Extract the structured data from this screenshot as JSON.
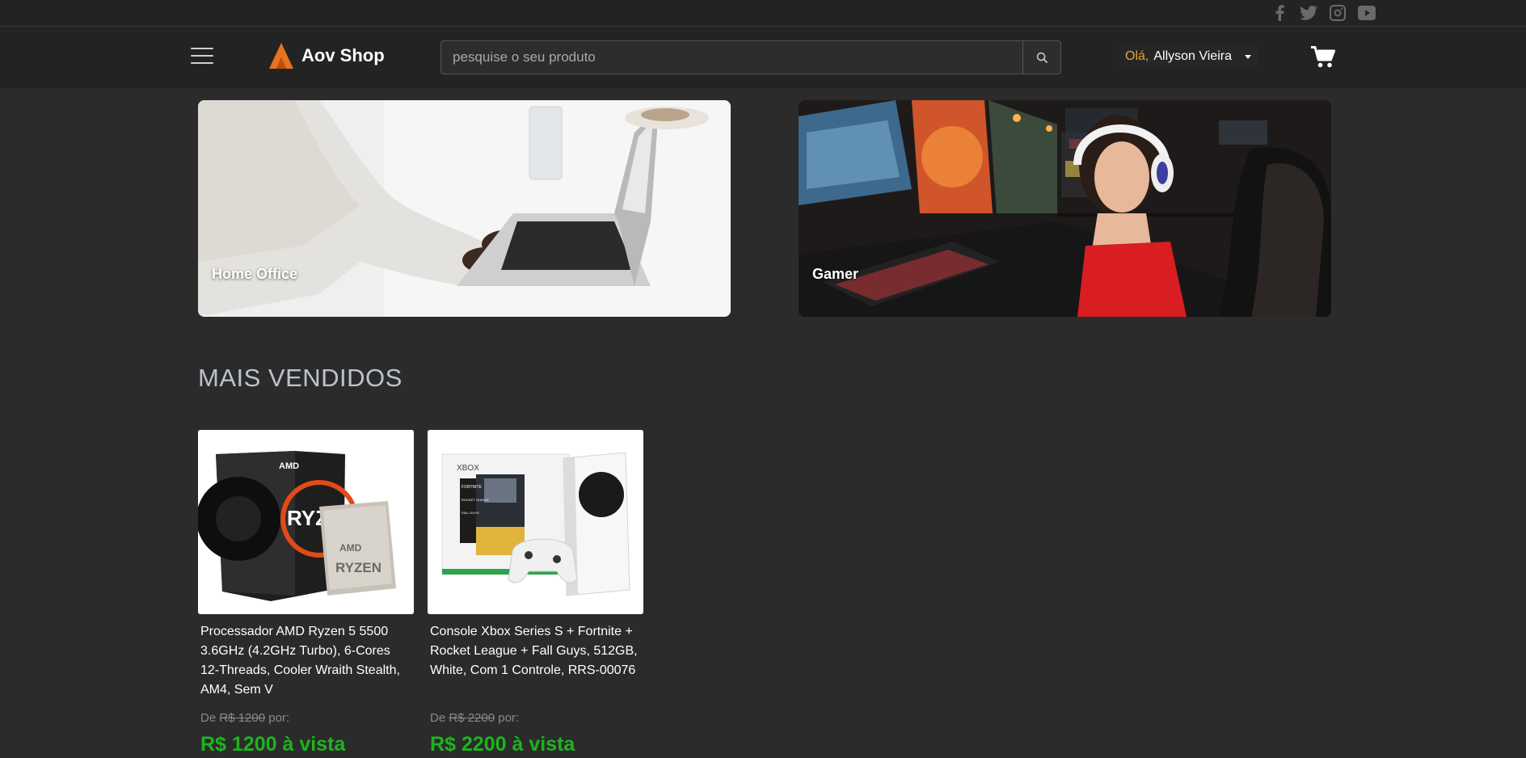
{
  "social": {
    "icons": [
      "facebook-icon",
      "twitter-icon",
      "instagram-icon",
      "youtube-icon"
    ]
  },
  "header": {
    "brand": "Aov Shop",
    "search_placeholder": "pesquise o seu produto",
    "greeting": "Olá,",
    "user_name": "Allyson Vieira",
    "colors": {
      "accent": "#f0a030",
      "logo": "#e8731f",
      "price": "#1db41d"
    }
  },
  "banners": [
    {
      "label": "Home Office"
    },
    {
      "label": "Gamer"
    }
  ],
  "section": {
    "title": "MAIS VENDIDOS"
  },
  "products": [
    {
      "title": "Processador AMD Ryzen 5 5500 3.6GHz (4.2GHz Turbo), 6-Cores 12-Threads, Cooler Wraith Stealth, AM4, Sem V",
      "old_prefix": "De",
      "old_price": "R$ 1200",
      "old_suffix": "por:",
      "price": "R$ 1200 à vista",
      "img_text": {
        "brand": "AMD",
        "chip_brand": "AMD",
        "chip_model": "RYZEN",
        "box_model": "RYZ"
      }
    },
    {
      "title": "Console Xbox Series S + Fortnite + Rocket League + Fall Guys, 512GB, White, Com 1 Controle, RRS-00076",
      "old_prefix": "De",
      "old_price": "R$ 2200",
      "old_suffix": "por:",
      "price": "R$ 2200 à vista",
      "img_text": {
        "brand": "XBOX",
        "game1": "FORTNITE",
        "game2": "ROCKET LEAGUE",
        "game3": "FALL GUYS"
      }
    }
  ]
}
